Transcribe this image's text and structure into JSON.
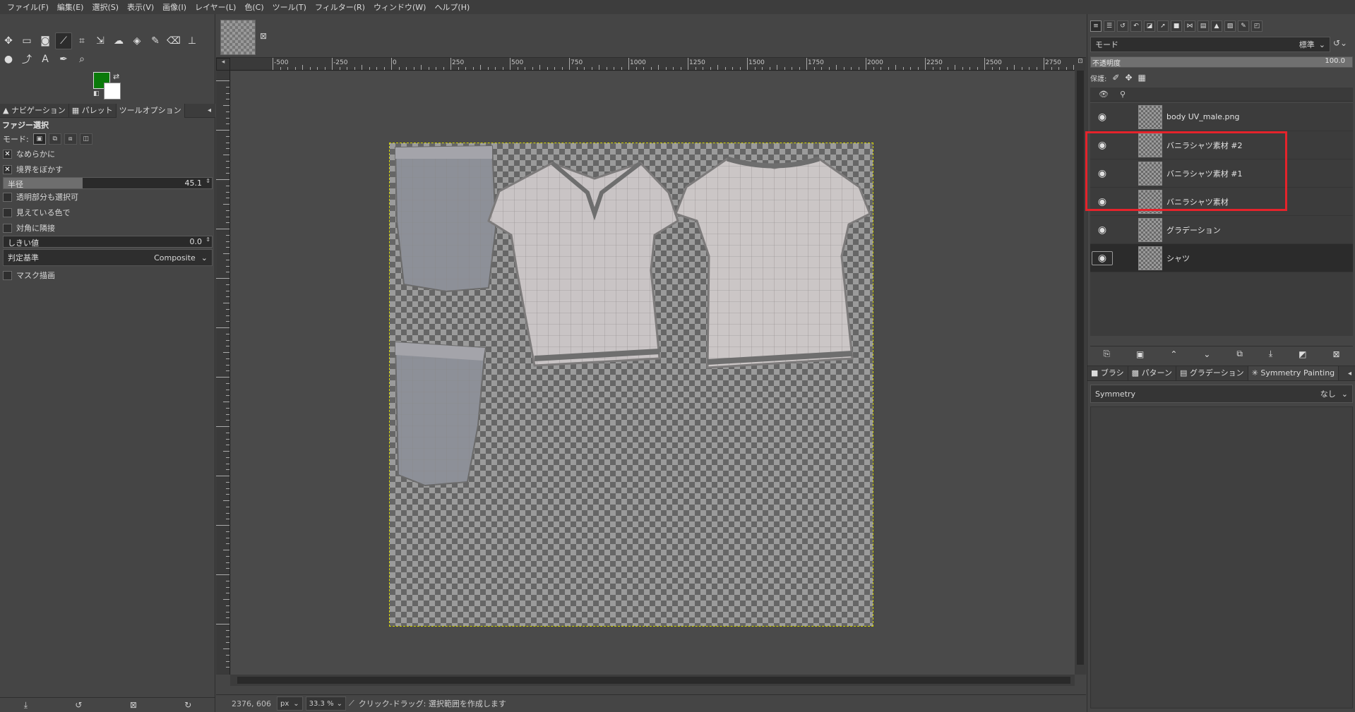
{
  "menubar": [
    "ファイル(F)",
    "編集(E)",
    "選択(S)",
    "表示(V)",
    "画像(I)",
    "レイヤー(L)",
    "色(C)",
    "ツール(T)",
    "フィルター(R)",
    "ウィンドウ(W)",
    "ヘルプ(H)"
  ],
  "toolbox": {
    "tools": [
      "move-tool",
      "rect-select-tool",
      "foreground-select-tool",
      "fuzzy-select-tool",
      "crop-tool",
      "unified-transform-tool",
      "warp-tool",
      "bucket-fill-tool",
      "paintbrush-tool",
      "eraser-tool",
      "clone-tool",
      "smudge-tool",
      "paths-tool",
      "text-tool",
      "color-picker-tool",
      "zoom-tool"
    ],
    "active_tool": "fuzzy-select-tool",
    "foreground_color": "#0a7a0a",
    "background_color": "#ffffff"
  },
  "left_tabs": [
    "ナビゲーション",
    "パレット",
    "ツールオプション"
  ],
  "tool_options": {
    "title": "ファジー選択",
    "mode_label": "モード:",
    "antialias_label": "なめらかに",
    "antialias_checked": true,
    "feather_label": "境界をぼかす",
    "feather_checked": true,
    "radius_label": "半径",
    "radius_value": "45.1",
    "radius_fraction": 0.38,
    "transparent_label": "透明部分も選択可",
    "sample_merged_label": "見えている色で",
    "diagonal_label": "対角に隣接",
    "threshold_label": "しきい値",
    "threshold_value": "0.0",
    "criterion_label": "判定基準",
    "criterion_value": "Composite",
    "draw_mask_label": "マスク描画"
  },
  "ruler_top": [
    "-500",
    "-250",
    "0",
    "250",
    "500",
    "750",
    "1000",
    "1250",
    "1500",
    "1750",
    "2000",
    "2250",
    "2500",
    "2750"
  ],
  "status": {
    "coords": "2376, 606",
    "unit": "px",
    "zoom": "33.3 %",
    "message": "クリック-ドラッグ: 選択範囲を作成します"
  },
  "layers_panel": {
    "mode_label": "モード",
    "mode_value": "標準",
    "opacity_label": "不透明度",
    "opacity_value": "100.0",
    "lock_label": "保護:",
    "layers": [
      {
        "name": "body UV_male.png",
        "visible": true,
        "selected": false
      },
      {
        "name": "バニラシャツ素材 #2",
        "visible": true,
        "selected": false
      },
      {
        "name": "バニラシャツ素材 #1",
        "visible": true,
        "selected": false
      },
      {
        "name": "バニラシャツ素材",
        "visible": true,
        "selected": false
      },
      {
        "name": "グラデーション",
        "visible": true,
        "selected": false
      },
      {
        "name": "シャツ",
        "visible": true,
        "selected": true
      }
    ]
  },
  "bottom_tabs": [
    "ブラシ",
    "パターン",
    "グラデーション",
    "Symmetry Painting"
  ],
  "symmetry": {
    "label": "Symmetry",
    "value": "なし"
  },
  "colors": {
    "highlight": "#e5232b",
    "selection_marquee": "#d6d600"
  }
}
